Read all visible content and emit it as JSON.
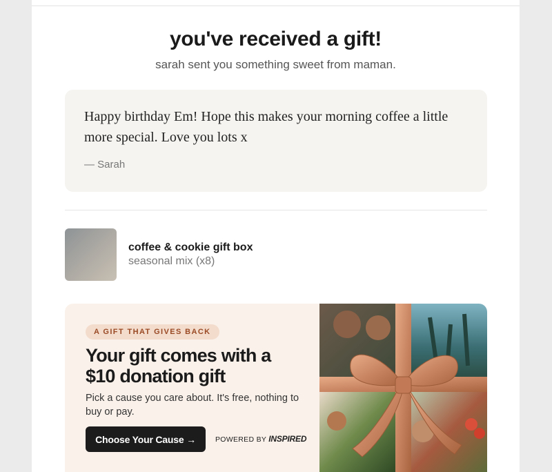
{
  "header": {
    "title": "you've received a gift!",
    "subtitle": "sarah sent you something sweet from maman."
  },
  "message": {
    "text": "Happy birthday Em! Hope this makes your morning coffee a little more special. Love you lots x",
    "signature": "— Sarah"
  },
  "product": {
    "name": "coffee & cookie gift box",
    "variant": "seasonal mix (x8)"
  },
  "donation": {
    "badge": "A GIFT THAT GIVES BACK",
    "headline": "Your gift comes with a $10 donation gift",
    "description": "Pick a cause you care about. It's free, nothing to buy or pay.",
    "cta_label": "Choose Your Cause →",
    "powered_by_label": "POWERED BY",
    "powered_by_brand": "INSPIRED"
  },
  "colors": {
    "page_background": "#ebebeb",
    "message_card": "#f5f4f0",
    "donation_card": "#faf1ea",
    "badge_bg": "#f3dccc",
    "badge_text": "#9a4a25",
    "cta_bg": "#1c1c1c",
    "ribbon": "#d4926d"
  },
  "icons": {
    "gift_image": "ribbon-gift-collage"
  }
}
